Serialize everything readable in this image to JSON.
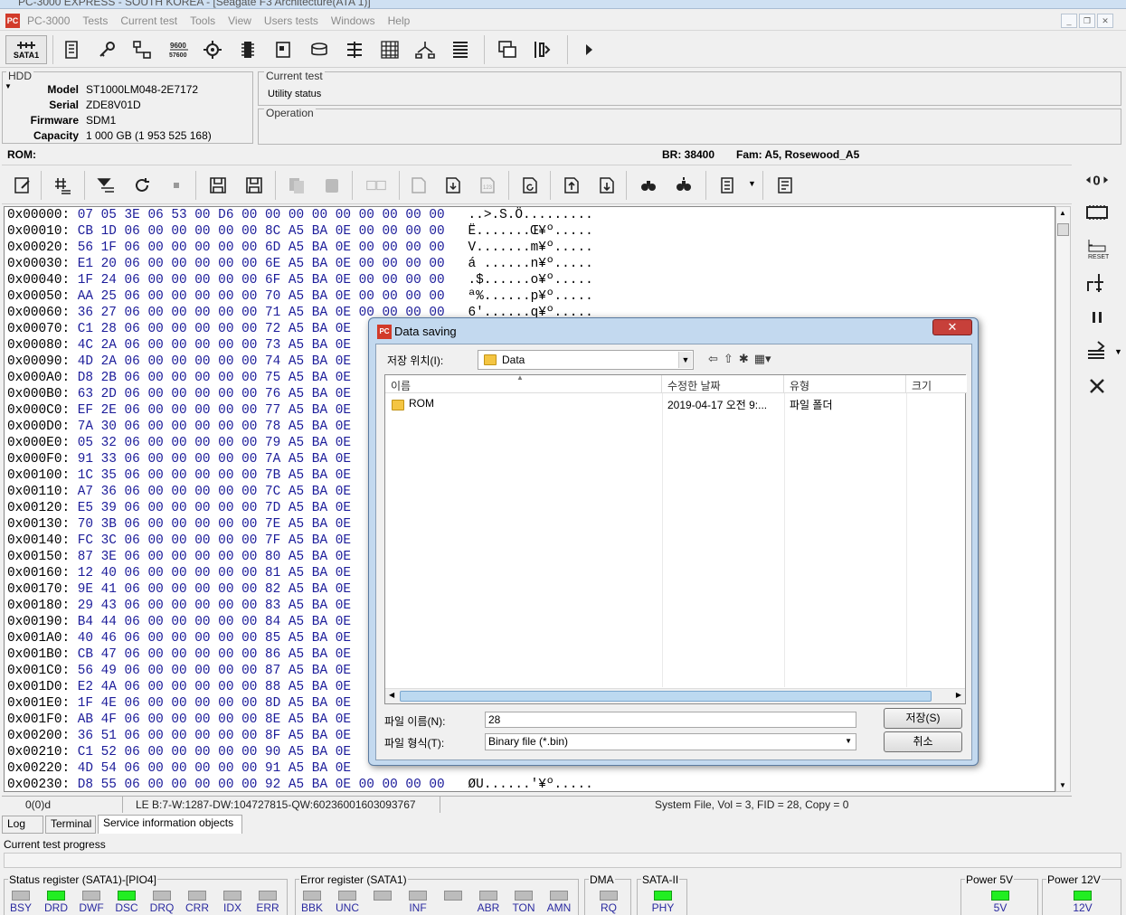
{
  "titlebar": {
    "text": "PC-3000 EXPRESS - SOUTH KOREA - [Seagate F3 Architecture(ATA 1)]"
  },
  "menu": [
    "PC-3000",
    "Tests",
    "Current test",
    "Tools",
    "View",
    "Users tests",
    "Windows",
    "Help"
  ],
  "toolbar": {
    "sata_label": "SATA1"
  },
  "hdd": {
    "title": "HDD",
    "model_key": "Model",
    "model": "ST1000LM048-2E7172",
    "serial_key": "Serial",
    "serial": "ZDE8V01D",
    "firmware_key": "Firmware",
    "firmware": "SDM1",
    "capacity_key": "Capacity",
    "capacity": "1 000 GB (1 953 525 168)"
  },
  "current_test": {
    "title": "Current test",
    "status": "Utility status"
  },
  "operation": {
    "title": "Operation"
  },
  "rom_bar": {
    "label": "ROM:",
    "br": "BR: 38400",
    "fam": "Fam: A5, Rosewood_A5"
  },
  "hex_rows": [
    {
      "o": "0x00000:",
      "b": "07 05 3E 06 53 00 D6 00 00 00 00 00 00 00 00 00",
      "a": "..>.S.Ö........."
    },
    {
      "o": "0x00010:",
      "b": "CB 1D 06 00 00 00 00 00 8C A5 BA 0E 00 00 00 00",
      "a": "Ë.......Œ¥º....."
    },
    {
      "o": "0x00020:",
      "b": "56 1F 06 00 00 00 00 00 6D A5 BA 0E 00 00 00 00",
      "a": "V.......m¥º....."
    },
    {
      "o": "0x00030:",
      "b": "E1 20 06 00 00 00 00 00 6E A5 BA 0E 00 00 00 00",
      "a": "á ......n¥º....."
    },
    {
      "o": "0x00040:",
      "b": "1F 24 06 00 00 00 00 00 6F A5 BA 0E 00 00 00 00",
      "a": ".$......o¥º....."
    },
    {
      "o": "0x00050:",
      "b": "AA 25 06 00 00 00 00 00 70 A5 BA 0E 00 00 00 00",
      "a": "ª%......p¥º....."
    },
    {
      "o": "0x00060:",
      "b": "36 27 06 00 00 00 00 00 71 A5 BA 0E 00 00 00 00",
      "a": "6'......q¥º....."
    },
    {
      "o": "0x00070:",
      "b": "C1 28 06 00 00 00 00 00 72 A5 BA 0E",
      "a": ""
    },
    {
      "o": "0x00080:",
      "b": "4C 2A 06 00 00 00 00 00 73 A5 BA 0E",
      "a": ""
    },
    {
      "o": "0x00090:",
      "b": "4D 2A 06 00 00 00 00 00 74 A5 BA 0E",
      "a": ""
    },
    {
      "o": "0x000A0:",
      "b": "D8 2B 06 00 00 00 00 00 75 A5 BA 0E",
      "a": ""
    },
    {
      "o": "0x000B0:",
      "b": "63 2D 06 00 00 00 00 00 76 A5 BA 0E",
      "a": ""
    },
    {
      "o": "0x000C0:",
      "b": "EF 2E 06 00 00 00 00 00 77 A5 BA 0E",
      "a": ""
    },
    {
      "o": "0x000D0:",
      "b": "7A 30 06 00 00 00 00 00 78 A5 BA 0E",
      "a": ""
    },
    {
      "o": "0x000E0:",
      "b": "05 32 06 00 00 00 00 00 79 A5 BA 0E",
      "a": ""
    },
    {
      "o": "0x000F0:",
      "b": "91 33 06 00 00 00 00 00 7A A5 BA 0E",
      "a": ""
    },
    {
      "o": "0x00100:",
      "b": "1C 35 06 00 00 00 00 00 7B A5 BA 0E",
      "a": ""
    },
    {
      "o": "0x00110:",
      "b": "A7 36 06 00 00 00 00 00 7C A5 BA 0E",
      "a": ""
    },
    {
      "o": "0x00120:",
      "b": "E5 39 06 00 00 00 00 00 7D A5 BA 0E",
      "a": ""
    },
    {
      "o": "0x00130:",
      "b": "70 3B 06 00 00 00 00 00 7E A5 BA 0E",
      "a": ""
    },
    {
      "o": "0x00140:",
      "b": "FC 3C 06 00 00 00 00 00 7F A5 BA 0E",
      "a": ""
    },
    {
      "o": "0x00150:",
      "b": "87 3E 06 00 00 00 00 00 80 A5 BA 0E",
      "a": ""
    },
    {
      "o": "0x00160:",
      "b": "12 40 06 00 00 00 00 00 81 A5 BA 0E",
      "a": ""
    },
    {
      "o": "0x00170:",
      "b": "9E 41 06 00 00 00 00 00 82 A5 BA 0E",
      "a": ""
    },
    {
      "o": "0x00180:",
      "b": "29 43 06 00 00 00 00 00 83 A5 BA 0E",
      "a": ""
    },
    {
      "o": "0x00190:",
      "b": "B4 44 06 00 00 00 00 00 84 A5 BA 0E",
      "a": ""
    },
    {
      "o": "0x001A0:",
      "b": "40 46 06 00 00 00 00 00 85 A5 BA 0E",
      "a": ""
    },
    {
      "o": "0x001B0:",
      "b": "CB 47 06 00 00 00 00 00 86 A5 BA 0E",
      "a": ""
    },
    {
      "o": "0x001C0:",
      "b": "56 49 06 00 00 00 00 00 87 A5 BA 0E",
      "a": ""
    },
    {
      "o": "0x001D0:",
      "b": "E2 4A 06 00 00 00 00 00 88 A5 BA 0E",
      "a": ""
    },
    {
      "o": "0x001E0:",
      "b": "1F 4E 06 00 00 00 00 00 8D A5 BA 0E",
      "a": ""
    },
    {
      "o": "0x001F0:",
      "b": "AB 4F 06 00 00 00 00 00 8E A5 BA 0E",
      "a": ""
    },
    {
      "o": "0x00200:",
      "b": "36 51 06 00 00 00 00 00 8F A5 BA 0E",
      "a": ""
    },
    {
      "o": "0x00210:",
      "b": "C1 52 06 00 00 00 00 00 90 A5 BA 0E",
      "a": ""
    },
    {
      "o": "0x00220:",
      "b": "4D 54 06 00 00 00 00 00 91 A5 BA 0E",
      "a": ""
    },
    {
      "o": "0x00230:",
      "b": "D8 55 06 00 00 00 00 00 92 A5 BA 0E 00 00 00 00",
      "a": "ØU......'¥º....."
    }
  ],
  "status_bar": {
    "pos": "0(0)d",
    "le": "LE B:7-W:1287-DW:104727815-QW:60236001603093767",
    "sysfile": "System File, Vol = 3, FID = 28, Copy = 0"
  },
  "tabs": {
    "log": "Log",
    "terminal": "Terminal",
    "service": "Service information objects"
  },
  "progress": {
    "label": "Current test progress"
  },
  "status_register": {
    "title": "Status register (SATA1)-[PIO4]",
    "leds": [
      {
        "name": "BSY",
        "on": false
      },
      {
        "name": "DRD",
        "on": true
      },
      {
        "name": "DWF",
        "on": false
      },
      {
        "name": "DSC",
        "on": true
      },
      {
        "name": "DRQ",
        "on": false
      },
      {
        "name": "CRR",
        "on": false
      },
      {
        "name": "IDX",
        "on": false
      },
      {
        "name": "ERR",
        "on": false
      }
    ]
  },
  "error_register": {
    "title": "Error register (SATA1)",
    "leds": [
      {
        "name": "BBK",
        "on": false
      },
      {
        "name": "UNC",
        "on": false
      },
      {
        "name": "",
        "on": false
      },
      {
        "name": "INF",
        "on": false
      },
      {
        "name": "",
        "on": false
      },
      {
        "name": "ABR",
        "on": false
      },
      {
        "name": "TON",
        "on": false
      },
      {
        "name": "AMN",
        "on": false
      }
    ]
  },
  "dma": {
    "title": "DMA",
    "led": "RQ"
  },
  "sata2": {
    "title": "SATA-II",
    "led": "PHY"
  },
  "power5": {
    "title": "Power 5V",
    "led": "5V"
  },
  "power12": {
    "title": "Power 12V",
    "led": "12V"
  },
  "dialog": {
    "title": "Data saving",
    "close": "✕",
    "location_label": "저장 위치(I):",
    "location_value": "Data",
    "columns": {
      "name": "이름",
      "date": "수정한 날짜",
      "type": "유형",
      "size": "크기"
    },
    "rows": [
      {
        "name": "ROM",
        "date": "2019-04-17 오전 9:...",
        "type": "파일 폴더",
        "size": ""
      }
    ],
    "filename_label": "파일 이름(N):",
    "filename_value": "28",
    "filetype_label": "파일 형식(T):",
    "filetype_value": "Binary file (*.bin)",
    "save_button": "저장(S)",
    "cancel_button": "취소"
  },
  "colors": {
    "led_on": "#22ee22",
    "led_off": "#bcbcbc",
    "hex_bytes": "#1c1c9a",
    "dialog_frame": "#c3d9ef",
    "close_button": "#c7403a"
  }
}
